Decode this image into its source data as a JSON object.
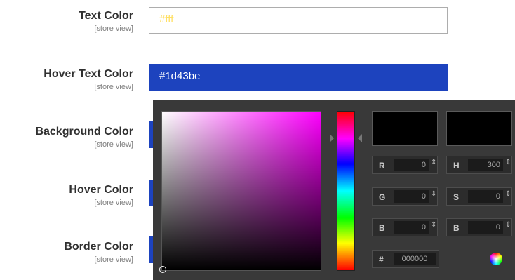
{
  "fields": [
    {
      "label": "Text Color",
      "scope": "[store view]",
      "value": "#fff"
    },
    {
      "label": "Hover Text Color",
      "scope": "[store view]",
      "value": "#1d43be"
    },
    {
      "label": "Background Color",
      "scope": "[store view]"
    },
    {
      "label": "Hover Color",
      "scope": "[store view]"
    },
    {
      "label": "Border Color",
      "scope": "[store view]"
    }
  ],
  "picker": {
    "channels": {
      "r": {
        "letter": "R",
        "value": "0"
      },
      "g": {
        "letter": "G",
        "value": "0"
      },
      "b": {
        "letter": "B",
        "value": "0"
      },
      "h": {
        "letter": "H",
        "value": "300"
      },
      "s": {
        "letter": "S",
        "value": "0"
      },
      "b2": {
        "letter": "B",
        "value": "0"
      }
    },
    "hex": {
      "symbol": "#",
      "value": "000000"
    },
    "new_color": "#000000",
    "current_color": "#000000",
    "spin_glyph": "⇕"
  }
}
